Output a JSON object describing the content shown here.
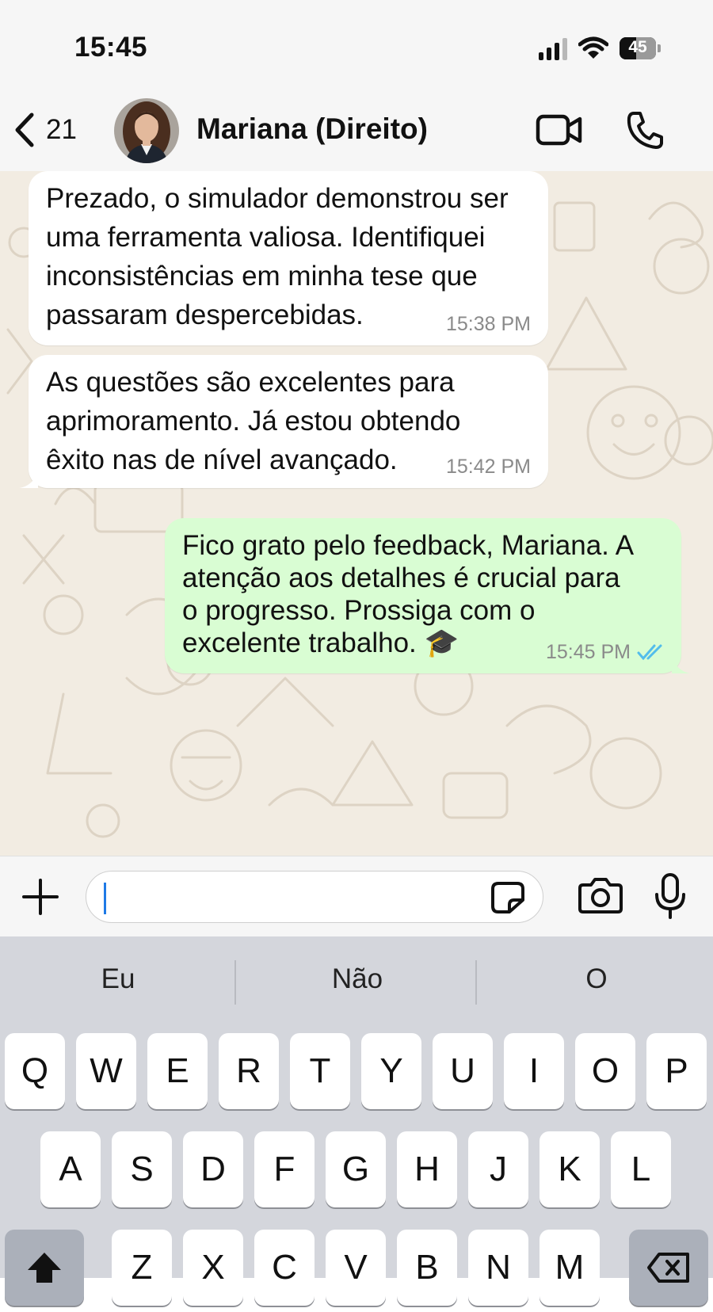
{
  "status_bar": {
    "time": "15:45",
    "battery_level": "45",
    "icons": [
      "signal-icon",
      "wifi-icon",
      "battery-icon"
    ]
  },
  "header": {
    "unread_count": "21",
    "contact_name": "Mariana (Direito)",
    "icons": [
      "back-chevron-icon",
      "avatar",
      "video-call-icon",
      "phone-icon"
    ]
  },
  "messages": [
    {
      "direction": "incoming",
      "lines": [
        "Prezado, o simulador demonstrou ser",
        "uma ferramenta valiosa. Identifiquei",
        "inconsistências em minha tese que",
        "passaram despercebidas."
      ],
      "time": "15:38 PM"
    },
    {
      "direction": "incoming",
      "lines": [
        "As questões são excelentes para",
        "aprimoramento. Já estou obtendo",
        "êxito nas de nível avançado."
      ],
      "time": "15:42 PM"
    },
    {
      "direction": "outgoing",
      "lines": [
        "Fico grato pelo feedback, Mariana. A",
        "atenção aos detalhes é crucial para",
        "o progresso. Prossiga com o",
        "excelente trabalho. 🎓"
      ],
      "time": "15:45 PM",
      "status_icon": "double-check-read-icon"
    }
  ],
  "input_bar": {
    "placeholder": "",
    "value": "",
    "icons": [
      "plus-icon",
      "sticker-icon",
      "camera-icon",
      "microphone-icon"
    ]
  },
  "keyboard": {
    "suggestions": [
      "Eu",
      "Não",
      "O"
    ],
    "rows": [
      [
        "Q",
        "W",
        "E",
        "R",
        "T",
        "Y",
        "U",
        "I",
        "O",
        "P"
      ],
      [
        "A",
        "S",
        "D",
        "F",
        "G",
        "H",
        "J",
        "K",
        "L"
      ],
      [
        "Z",
        "X",
        "C",
        "V",
        "B",
        "N",
        "M"
      ]
    ],
    "icons": [
      "shift-icon",
      "backspace-icon"
    ]
  },
  "colors": {
    "chat_background": "#f2ece2",
    "outgoing_bubble": "#d9fdd3",
    "incoming_bubble": "#ffffff",
    "read_ticks": "#53bdeb",
    "keyboard_background": "#d4d6dc"
  }
}
